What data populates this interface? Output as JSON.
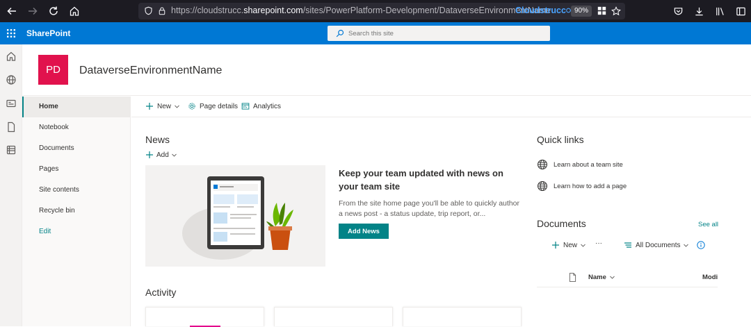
{
  "browser": {
    "url_prefix": "https://cloudstrucc.",
    "url_host": "sharepoint.com",
    "url_path": "/sites/PowerPlatform-Development/DataverseEnvironmentName",
    "extension_label": "Cloudstrucc",
    "zoom": "90%"
  },
  "suite": {
    "title": "SharePoint",
    "search_placeholder": "Search this site"
  },
  "site": {
    "logo_initials": "PD",
    "name": "DataverseEnvironmentName"
  },
  "nav": {
    "items": [
      {
        "label": "Home"
      },
      {
        "label": "Notebook"
      },
      {
        "label": "Documents"
      },
      {
        "label": "Pages"
      },
      {
        "label": "Site contents"
      },
      {
        "label": "Recycle bin"
      }
    ],
    "edit_label": "Edit"
  },
  "command_bar": {
    "new_label": "New",
    "page_details_label": "Page details",
    "analytics_label": "Analytics"
  },
  "news": {
    "title": "News",
    "add_label": "Add",
    "headline": "Keep your team updated with news on your team site",
    "body": "From the site home page you'll be able to quickly author a news post - a status update, trip report, or...",
    "button_label": "Add News"
  },
  "quick_links": {
    "title": "Quick links",
    "items": [
      {
        "label": "Learn about a team site"
      },
      {
        "label": "Learn how to add a page"
      }
    ]
  },
  "documents": {
    "title": "Documents",
    "see_all": "See all",
    "new_label": "New",
    "more_label": "···",
    "view_label": "All Documents",
    "columns": {
      "name": "Name",
      "modified": "Modi"
    }
  },
  "activity": {
    "title": "Activity"
  },
  "colors": {
    "suite_blue": "#0078d4",
    "accent_teal": "#038387",
    "logo_red": "#e1124d"
  }
}
